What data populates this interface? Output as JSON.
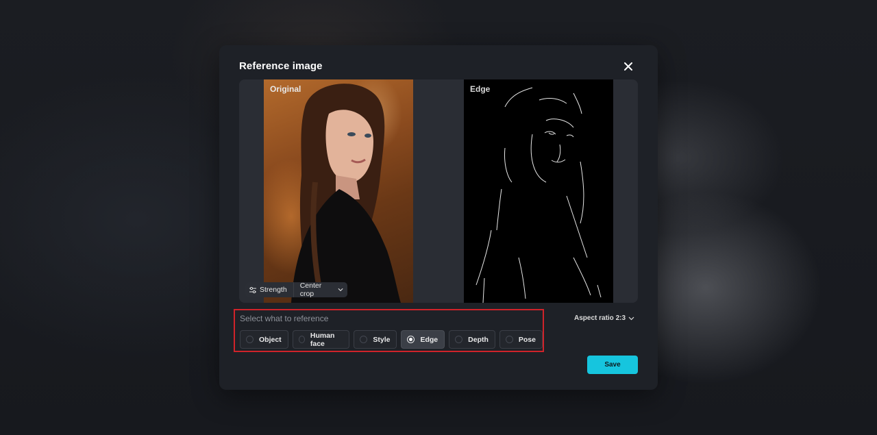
{
  "modal": {
    "title": "Reference image",
    "close_icon": "close-icon"
  },
  "preview": {
    "original_label": "Original",
    "edge_label": "Edge",
    "strength_label": "Strength",
    "strength_icon": "sliders-icon",
    "crop_label": "Center crop",
    "crop_icon": "chevron-down-icon"
  },
  "reference": {
    "label": "Select what to reference",
    "options": [
      {
        "label": "Object",
        "selected": false
      },
      {
        "label": "Human face",
        "selected": false
      },
      {
        "label": "Style",
        "selected": false
      },
      {
        "label": "Edge",
        "selected": true
      },
      {
        "label": "Depth",
        "selected": false
      },
      {
        "label": "Pose",
        "selected": false
      }
    ],
    "highlight_color": "#d0232a"
  },
  "aspect_ratio": {
    "label": "Aspect ratio 2:3",
    "icon": "chevron-down-icon"
  },
  "actions": {
    "save_label": "Save",
    "save_color": "#16c5de"
  }
}
